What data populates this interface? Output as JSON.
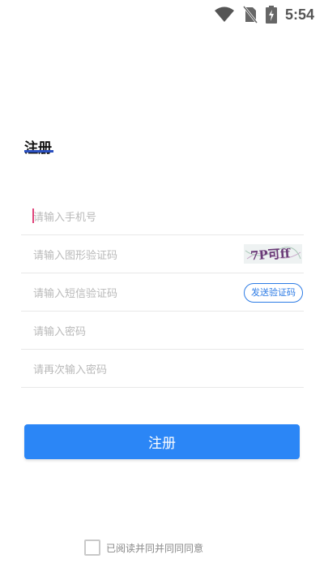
{
  "status_bar": {
    "time": "5:54",
    "icons": [
      "wifi-icon",
      "no-sim-icon",
      "battery-charging-icon"
    ]
  },
  "page": {
    "title": "注册"
  },
  "form": {
    "phone_placeholder": "请输入手机号",
    "captcha_placeholder": "请输入图形验证码",
    "captcha_image_text": "7P可ff",
    "sms_placeholder": "请输入短信验证码",
    "send_sms_label": "发送验证码",
    "password_placeholder": "请输入密码",
    "confirm_password_placeholder": "请再次输入密码",
    "submit_label": "注册"
  },
  "agreement": {
    "text": "已阅读并同并同同同意"
  },
  "colors": {
    "primary": "#2b86f6",
    "accent_underline": "#2a4fbf",
    "cursor": "#e0457b"
  }
}
